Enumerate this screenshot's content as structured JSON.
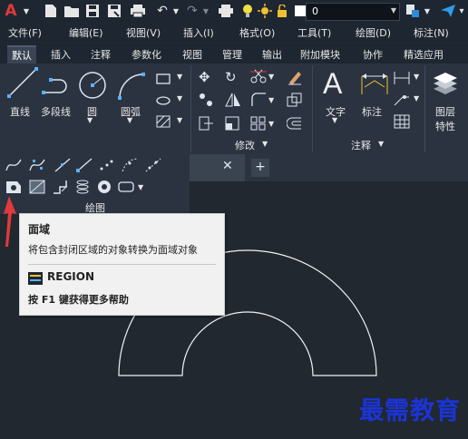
{
  "quick_access": {
    "app_icon": "autocad-logo-icon",
    "layer_value": "0",
    "icons": [
      "new-file-icon",
      "open-folder-icon",
      "save-icon",
      "save-as-icon",
      "print-icon",
      "undo-icon",
      "redo-icon",
      "plot-icon",
      "sun-icon",
      "lock-icon",
      "layer-color-icon",
      "match-properties-icon",
      "share-icon"
    ]
  },
  "menubar": {
    "items": [
      "文件(F)",
      "编辑(E)",
      "视图(V)",
      "插入(I)",
      "格式(O)",
      "工具(T)",
      "绘图(D)",
      "标注(N)"
    ]
  },
  "ribbon_tabs": {
    "items": [
      "默认",
      "插入",
      "注释",
      "参数化",
      "视图",
      "管理",
      "输出",
      "附加模块",
      "协作",
      "精选应用"
    ],
    "active": "默认"
  },
  "ribbon": {
    "draw_tools": [
      "直线",
      "多段线",
      "圆",
      "圆弧"
    ],
    "annotation_tools": [
      "文字",
      "标注"
    ],
    "layer_tool": [
      "图层",
      "特性"
    ],
    "modify_panel": "修改",
    "annotation_panel": "注释",
    "draw_panel": "绘图"
  },
  "tooltip": {
    "title": "面域",
    "description": "将包含封闭区域的对象转换为面域对象",
    "command": "REGION",
    "help": "按 F1 键获得更多帮助"
  },
  "watermark": "最需教育",
  "colors": {
    "accent_red": "#e03a3a",
    "watermark_blue": "#1b34d6",
    "canvas_bg": "#212830"
  }
}
